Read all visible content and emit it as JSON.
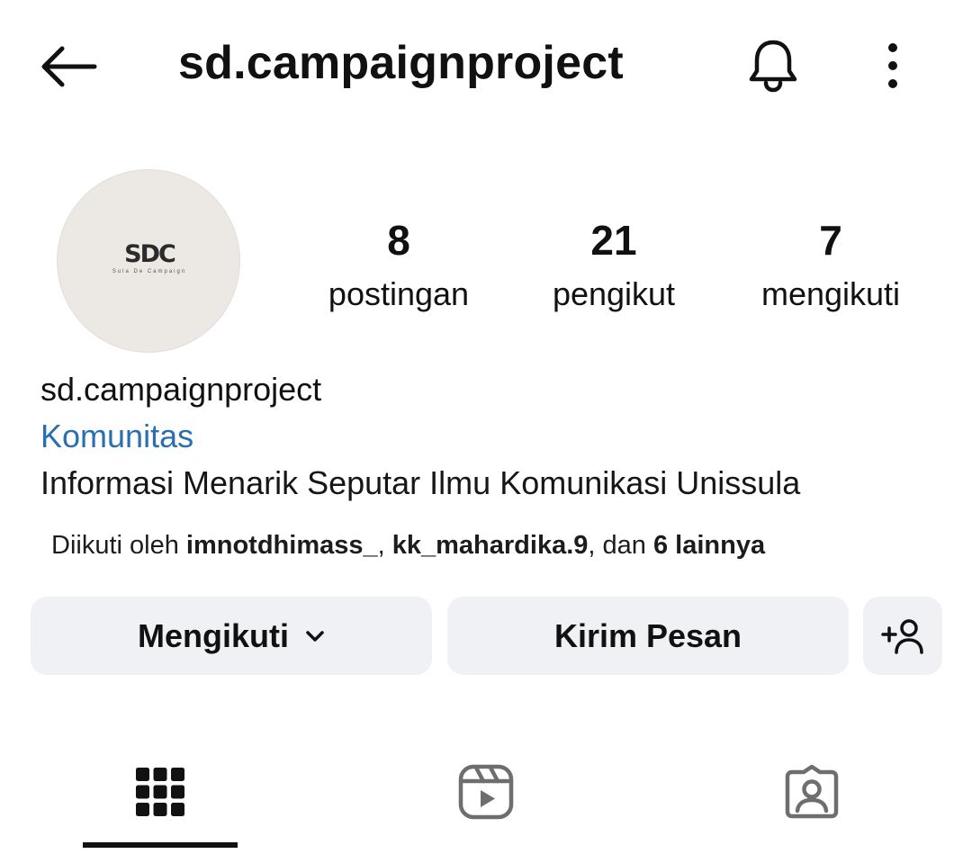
{
  "header": {
    "title": "sd.campaignproject",
    "back_icon": "arrow-left-icon",
    "bell_icon": "bell-icon",
    "more_icon": "more-vertical-icon"
  },
  "avatar": {
    "logo_text": "SDC",
    "logo_subtext": "Sula De Campaign"
  },
  "stats": [
    {
      "value": "8",
      "label": "postingan"
    },
    {
      "value": "21",
      "label": "pengikut"
    },
    {
      "value": "7",
      "label": "mengikuti"
    }
  ],
  "bio": {
    "name": "sd.campaignproject",
    "category": "Komunitas",
    "text": "Informasi Menarik Seputar Ilmu Komunikasi Unissula"
  },
  "followed_by": {
    "prefix": "Diikuti oleh ",
    "user1": "imnotdhimass_",
    "sep": ", ",
    "user2": "kk_mahardika.9",
    "mid": ", dan ",
    "others": "6 lainnya"
  },
  "actions": {
    "following_label": "Mengikuti",
    "message_label": "Kirim Pesan",
    "add_icon": "add-person-icon"
  },
  "tabs": {
    "active": "grid",
    "icons": [
      "grid-icon",
      "reels-icon",
      "tagged-icon"
    ]
  },
  "colors": {
    "category_link": "#2a6fb0",
    "button_bg": "#eff1f5",
    "tab_inactive": "#6e6e6e"
  }
}
